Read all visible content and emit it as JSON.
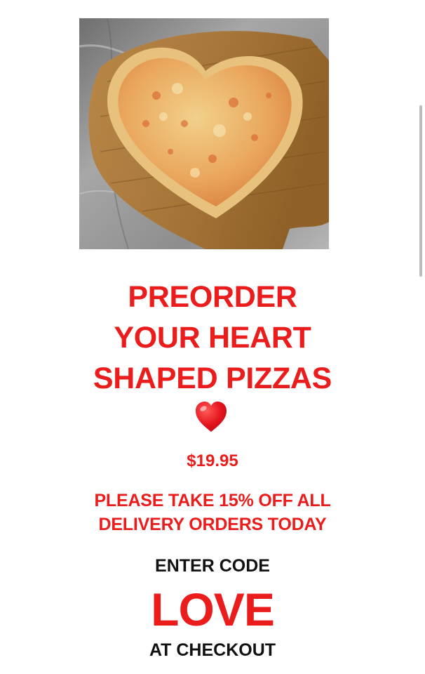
{
  "photo": {
    "alt_subject": "heart-shaped-pizza-on-wooden-peel"
  },
  "headline": {
    "line1": "PREORDER",
    "line2": "YOUR HEART",
    "line3": "SHAPED PIZZAS"
  },
  "emoji": "red-heart-icon",
  "price": "$19.95",
  "promo": {
    "line1": "PLEASE TAKE 15% OFF ALL",
    "line2": "DELIVERY ORDERS TODAY"
  },
  "code": {
    "prefix": "ENTER CODE",
    "value": "LOVE",
    "suffix": "AT CHECKOUT"
  },
  "colors": {
    "accent": "#ea1c1c",
    "text": "#111111",
    "background": "#ffffff"
  }
}
